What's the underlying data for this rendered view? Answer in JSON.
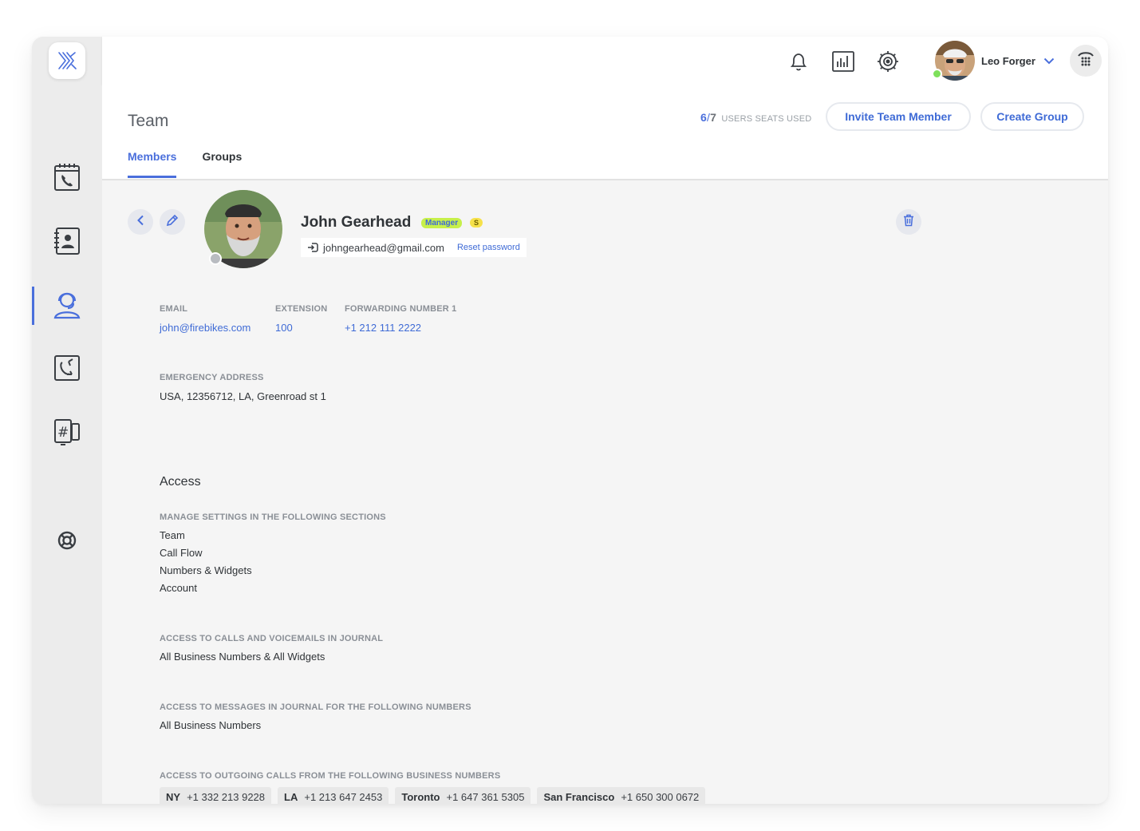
{
  "topbar": {
    "user_name": "Leo Forger"
  },
  "page": {
    "title": "Team",
    "seats_used": "6",
    "seats_total": "7",
    "seats_label": "USERS SEATS USED",
    "invite_button": "Invite Team Member",
    "create_group_button": "Create Group",
    "tabs": [
      "Members",
      "Groups"
    ]
  },
  "member": {
    "name": "John Gearhead",
    "role_badge": "Manager",
    "plan_badge": "S",
    "login_email": "johngearhead@gmail.com",
    "reset_password": "Reset password",
    "fields": {
      "email_label": "EMAIL",
      "email_value": "john@firebikes.com",
      "extension_label": "EXTENSION",
      "extension_value": "100",
      "forwarding_label": "FORWARDING NUMBER 1",
      "forwarding_value": "+1 212 111 2222",
      "emergency_label": "EMERGENCY ADDRESS",
      "emergency_value": "USA, 12356712, LA, Greenroad st 1"
    },
    "access": {
      "title": "Access",
      "manage_label": "MANAGE SETTINGS IN THE FOLLOWING SECTIONS",
      "manage_sections": [
        "Team",
        "Call Flow",
        "Numbers & Widgets",
        "Account"
      ],
      "calls_label": "ACCESS TO CALLS AND VOICEMAILS IN JOURNAL",
      "calls_value": "All Business Numbers & All Widgets",
      "messages_label": "ACCESS TO MESSAGES IN JOURNAL FOR THE FOLLOWING NUMBERS",
      "messages_value": "All Business Numbers",
      "outgoing_label": "ACCESS TO OUTGOING CALLS FROM THE FOLLOWING BUSINESS NUMBERS",
      "outgoing_numbers": [
        {
          "name": "NY",
          "number": "+1 332 213 9228"
        },
        {
          "name": "LA",
          "number": "+1 213 647 2453"
        },
        {
          "name": "Toronto",
          "number": "+1 647 361 5305"
        },
        {
          "name": "San Francisco",
          "number": "+1 650 300 0672"
        }
      ]
    }
  },
  "colors": {
    "accent": "#4a6fdc",
    "manager_badge": "#c7f04a",
    "plan_badge": "#f6e14a",
    "online": "#7ee05b"
  }
}
